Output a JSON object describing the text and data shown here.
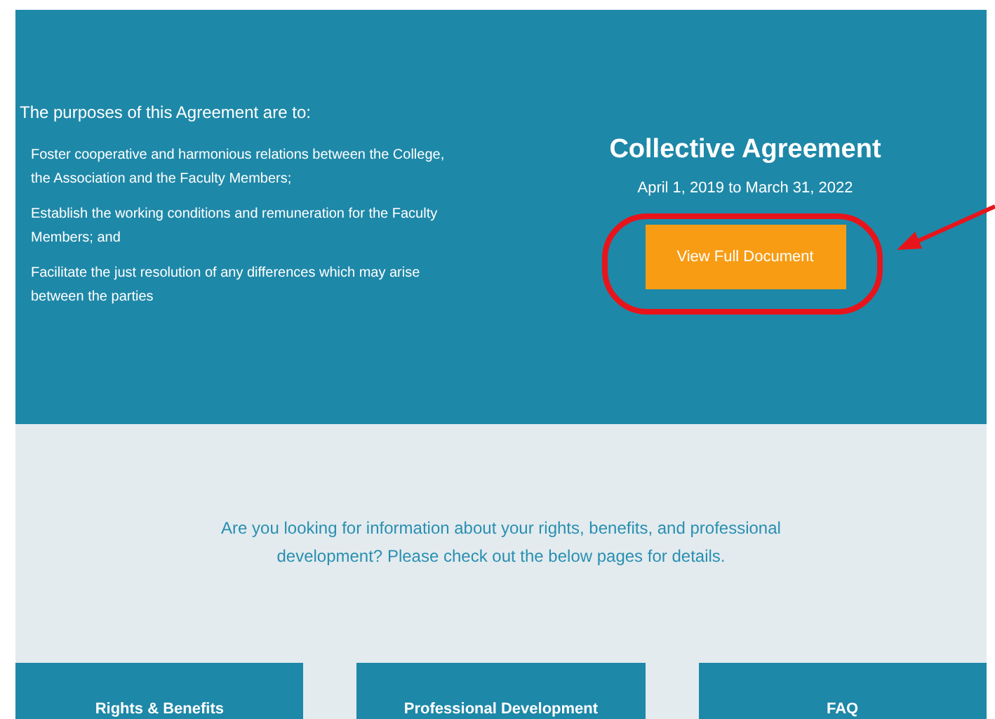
{
  "hero": {
    "intro": "The purposes of this Agreement are to:",
    "purposes": [
      "Foster cooperative and harmonious relations between the College, the Association and the Faculty Members;",
      "Establish the working conditions and remuneration for the Faculty Members; and",
      "Facilitate the just resolution of any differences which may arise between the parties"
    ],
    "title": "Collective Agreement",
    "dates": "April 1, 2019 to March 31, 2022",
    "button": "View Full Document",
    "highlighted": true
  },
  "info": {
    "text": "Are you looking for information about your rights, benefits, and professional development? Please check out the below pages for details."
  },
  "cards": [
    {
      "label": "Rights & Benefits"
    },
    {
      "label": "Professional Development"
    },
    {
      "label": "FAQ"
    }
  ]
}
